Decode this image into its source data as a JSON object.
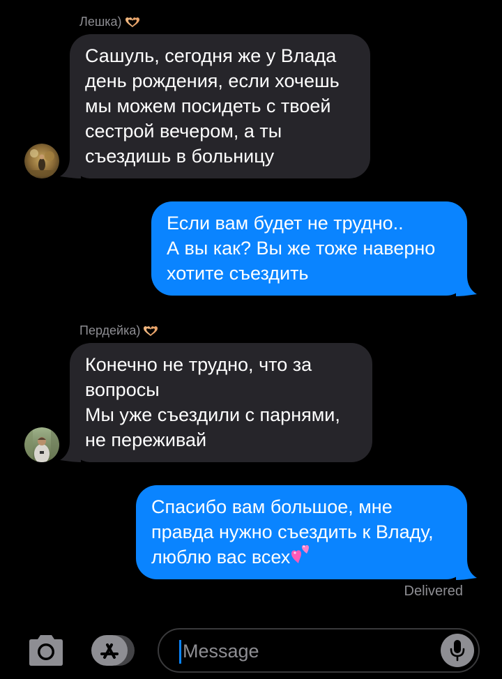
{
  "conversation": {
    "messages": [
      {
        "direction": "incoming",
        "sender": "Лешка)",
        "sender_emoji": "heart-hands",
        "lines": [
          "Сашуль, сегодня же у Влада",
          "день рождения, если хочешь",
          "мы можем посидеть с твоей",
          "сестрой вечером, а ты",
          "съездишь в больницу"
        ]
      },
      {
        "direction": "outgoing",
        "lines": [
          "Если вам будет не трудно..",
          "А вы как? Вы же тоже наверно",
          "хотите съездить"
        ]
      },
      {
        "direction": "incoming",
        "sender": "Пердейка)",
        "sender_emoji": "heart-hands",
        "lines": [
          "Конечно не трудно, что за",
          "вопросы",
          "Мы уже съездили с парнями,",
          "не переживай"
        ]
      },
      {
        "direction": "outgoing",
        "lines": [
          "Спасибо вам большое, мне",
          "правда нужно съездить к Владу,",
          "люблю вас всех"
        ],
        "trailing_emoji": "two-hearts"
      }
    ],
    "status": "Delivered"
  },
  "composer": {
    "placeholder": "Message",
    "value": "",
    "icons": [
      "camera-icon",
      "app-store-icon",
      "microphone-icon"
    ]
  },
  "colors": {
    "background": "#000000",
    "incoming_bubble": "#26252a",
    "outgoing_bubble": "#0a84ff",
    "secondary_text": "#8e8e93"
  }
}
